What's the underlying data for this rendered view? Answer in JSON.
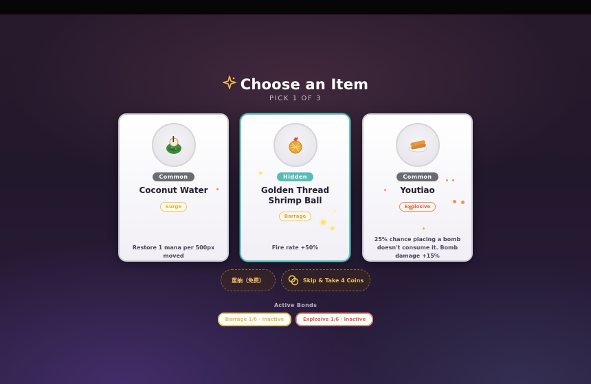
{
  "header": {
    "title": "Choose an Item",
    "subtitle": "PICK 1 OF 3"
  },
  "cards": [
    {
      "icon": "coconut-icon",
      "rarity": "Common",
      "name": "Coconut Water",
      "tag": "Surge",
      "description": "Restore 1 mana per 500px moved"
    },
    {
      "icon": "shrimp-ball-icon",
      "rarity": "Hidden",
      "name": "Golden Thread Shrimp Ball",
      "tag": "Barrage",
      "description": "Fire rate +50%"
    },
    {
      "icon": "youtiao-icon",
      "rarity": "Common",
      "name": "Youtiao",
      "tag": "Explosive",
      "description": "25% chance placing a bomb doesn't consume it. Bomb damage +15%"
    }
  ],
  "actions": {
    "reroll_label": "重抽（免费）",
    "skip_label": "Skip & Take 4 Coins"
  },
  "bonds": {
    "title": "Active Bonds",
    "items": [
      {
        "label": "Barrage 1/6 · Inactive"
      },
      {
        "label": "Explosive 1/6 · Inactive"
      }
    ]
  },
  "colors": {
    "accent_gold": "#f2c24a",
    "hidden_teal": "#55bdb5",
    "common_gray": "#6b6b72",
    "explosive_red": "#d9654a"
  }
}
